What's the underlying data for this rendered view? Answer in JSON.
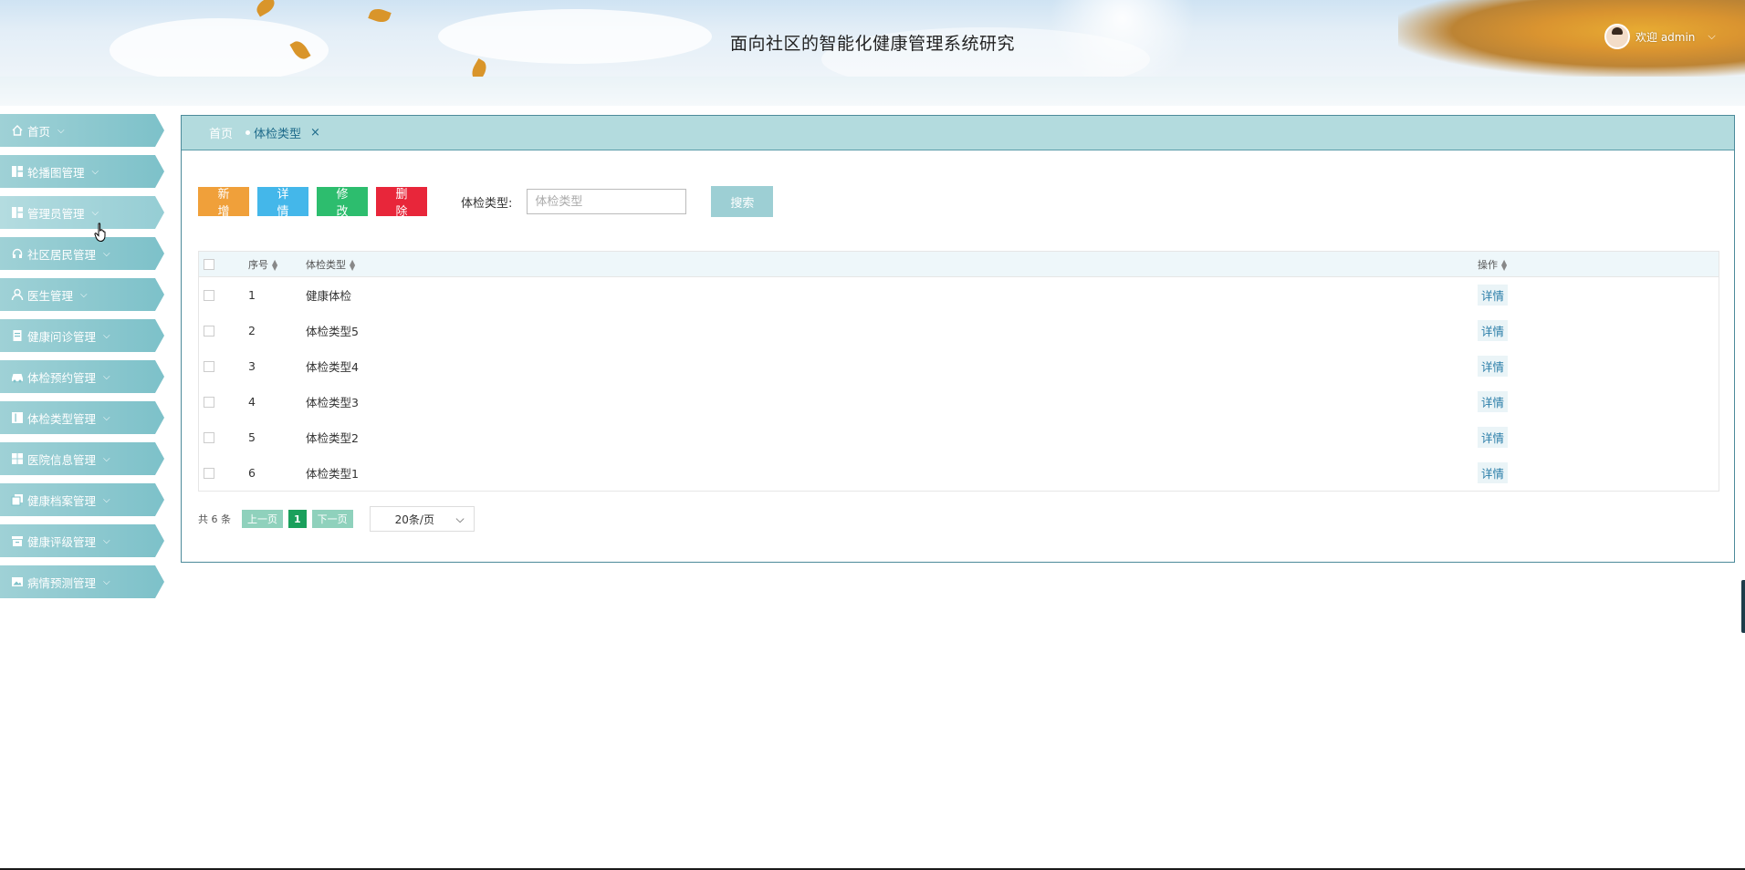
{
  "header": {
    "title": "面向社区的智能化健康管理系统研究",
    "user_text": "欢迎 admin",
    "chevron": "⌵"
  },
  "sidebar": {
    "items": [
      {
        "label": "首页",
        "icon": "home-icon"
      },
      {
        "label": "轮播图管理",
        "icon": "dashboard-icon"
      },
      {
        "label": "管理员管理",
        "icon": "dashboard-icon"
      },
      {
        "label": "社区居民管理",
        "icon": "headset-icon"
      },
      {
        "label": "医生管理",
        "icon": "user-icon"
      },
      {
        "label": "健康问诊管理",
        "icon": "document-icon"
      },
      {
        "label": "体检预约管理",
        "icon": "car-icon"
      },
      {
        "label": "体检类型管理",
        "icon": "layout-icon"
      },
      {
        "label": "医院信息管理",
        "icon": "grid-icon"
      },
      {
        "label": "健康档案管理",
        "icon": "copy-icon"
      },
      {
        "label": "健康评级管理",
        "icon": "archive-icon"
      },
      {
        "label": "病情预测管理",
        "icon": "image-icon"
      }
    ],
    "chevron": "⌵"
  },
  "tabs": {
    "home": "首页",
    "active": "体检类型",
    "close": "×"
  },
  "toolbar": {
    "add": "新增",
    "detail": "详情",
    "edit": "修改",
    "delete": "删除",
    "search_label": "体检类型:",
    "search_placeholder": "体检类型",
    "search_button": "搜索"
  },
  "table": {
    "headers": {
      "seq": "序号",
      "type": "体检类型",
      "op": "操作"
    },
    "rows": [
      {
        "seq": "1",
        "type": "健康体检",
        "op": "详情"
      },
      {
        "seq": "2",
        "type": "体检类型5",
        "op": "详情"
      },
      {
        "seq": "3",
        "type": "体检类型4",
        "op": "详情"
      },
      {
        "seq": "4",
        "type": "体检类型3",
        "op": "详情"
      },
      {
        "seq": "5",
        "type": "体检类型2",
        "op": "详情"
      },
      {
        "seq": "6",
        "type": "体检类型1",
        "op": "详情"
      }
    ]
  },
  "pager": {
    "total": "共 6 条",
    "prev": "上一页",
    "current": "1",
    "next": "下一页",
    "page_size": "20条/页",
    "chevron": "⌵"
  },
  "colors": {
    "accent": "#7dc1c9",
    "add": "#f0a03a",
    "detail": "#44b7ea",
    "edit": "#2dbd6e",
    "delete": "#e8263a"
  }
}
